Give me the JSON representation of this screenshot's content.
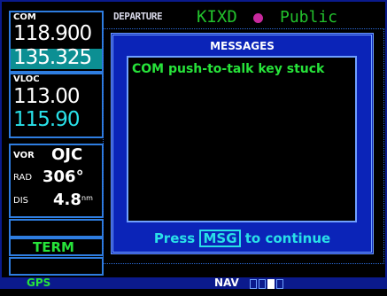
{
  "com": {
    "label": "COM",
    "active": "118.900",
    "standby": "135.325"
  },
  "vloc": {
    "label": "VLOC",
    "active": "113.00",
    "standby": "115.90"
  },
  "vor": {
    "label": "VOR",
    "ident": "OJC",
    "rad_label": "RAD",
    "rad_value": "306°",
    "dis_label": "DIS",
    "dis_value": "4.8",
    "dis_unit": "nm"
  },
  "cdi": {
    "mode": "TERM"
  },
  "page": {
    "title": "DEPARTURE",
    "waypoint": "KIXD",
    "type": "Public"
  },
  "messages": {
    "title": "MESSAGES",
    "items": [
      "COM push-to-talk key stuck"
    ],
    "footer_prefix": "Press",
    "footer_key": "MSG",
    "footer_suffix": "to continue"
  },
  "status": {
    "gps": "GPS",
    "nav": "NAV"
  }
}
